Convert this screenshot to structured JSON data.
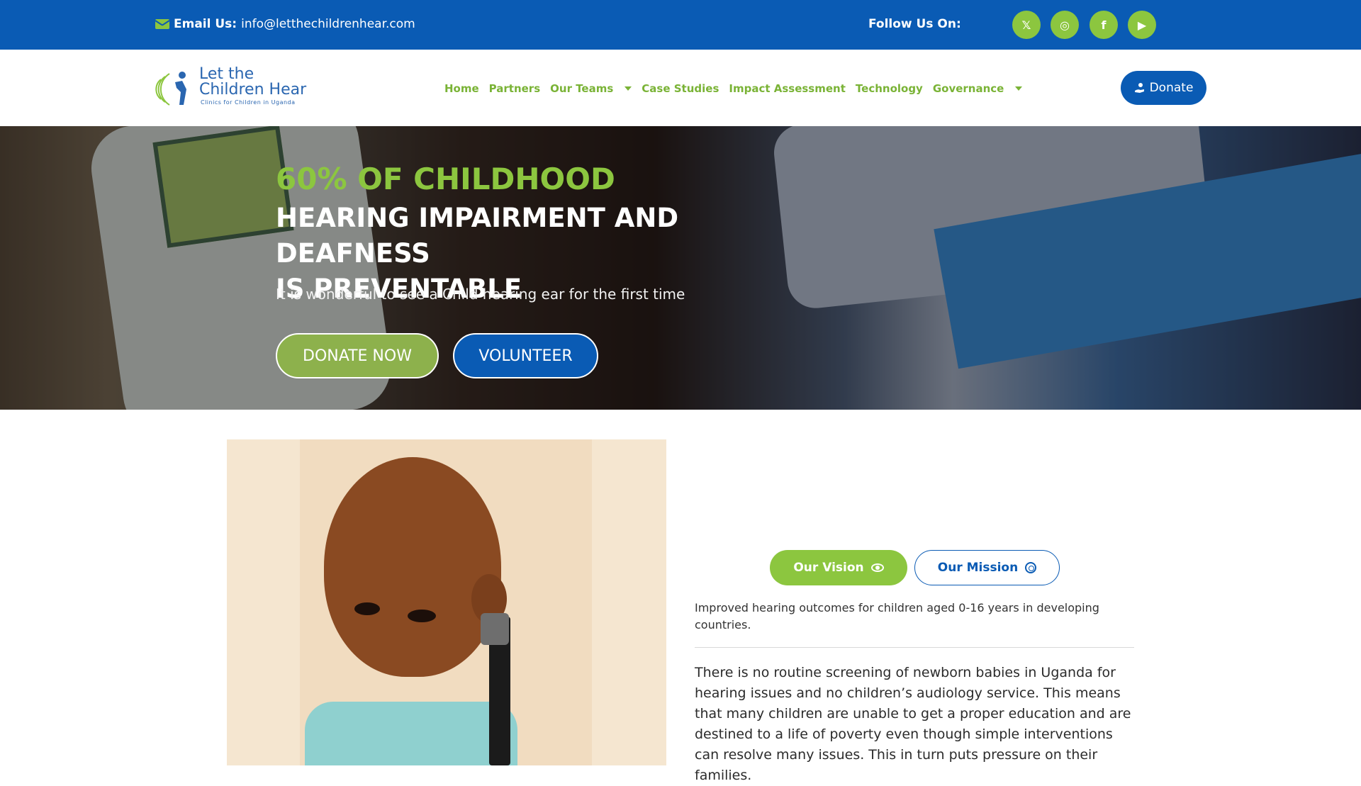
{
  "topbar": {
    "email_label": "Email Us:",
    "email_value": "info@letthechildrenhear.com",
    "follow_label": "Follow Us On:",
    "social": [
      {
        "name": "x-icon",
        "glyph": "𝕏"
      },
      {
        "name": "instagram-icon",
        "glyph": "◎"
      },
      {
        "name": "facebook-icon",
        "glyph": "f"
      },
      {
        "name": "youtube-icon",
        "glyph": "▶"
      }
    ]
  },
  "header": {
    "logo": {
      "line1": "Let the",
      "line2": "Children Hear",
      "line3": "Clinics for Children in Uganda"
    },
    "nav": [
      {
        "label": "Home",
        "dropdown": false
      },
      {
        "label": "Partners",
        "dropdown": false
      },
      {
        "label": "Our Teams",
        "dropdown": true
      },
      {
        "label": "Case Studies",
        "dropdown": false
      },
      {
        "label": "Impact Assessment",
        "dropdown": false
      },
      {
        "label": "Technology",
        "dropdown": false
      },
      {
        "label": "Governance",
        "dropdown": true
      }
    ],
    "donate_label": "Donate"
  },
  "hero": {
    "pre_title": "60% OF CHILDHOOD",
    "title_line1": "HEARING IMPAIRMENT AND DEAFNESS",
    "title_line2": "IS PREVENTABLE",
    "subtitle": "It is wonderful to see a Child hearing ear for the first time",
    "donate_now": "DONATE NOW",
    "volunteer": "VOLUNTEER"
  },
  "about": {
    "tab_vision": "Our Vision",
    "tab_mission": "Our Mission",
    "vision_text": "Improved hearing outcomes for children aged 0-16 years in developing countries.",
    "body_text": "There is no routine screening of newborn babies in Uganda for hearing issues and no children’s audiology service.  This means that many children are unable to get a proper education and are destined to a life of poverty even though simple interventions can resolve many issues.  This in turn puts pressure on their families."
  },
  "colors": {
    "brand_blue": "#0a5bb4",
    "brand_green": "#8cc63f"
  }
}
